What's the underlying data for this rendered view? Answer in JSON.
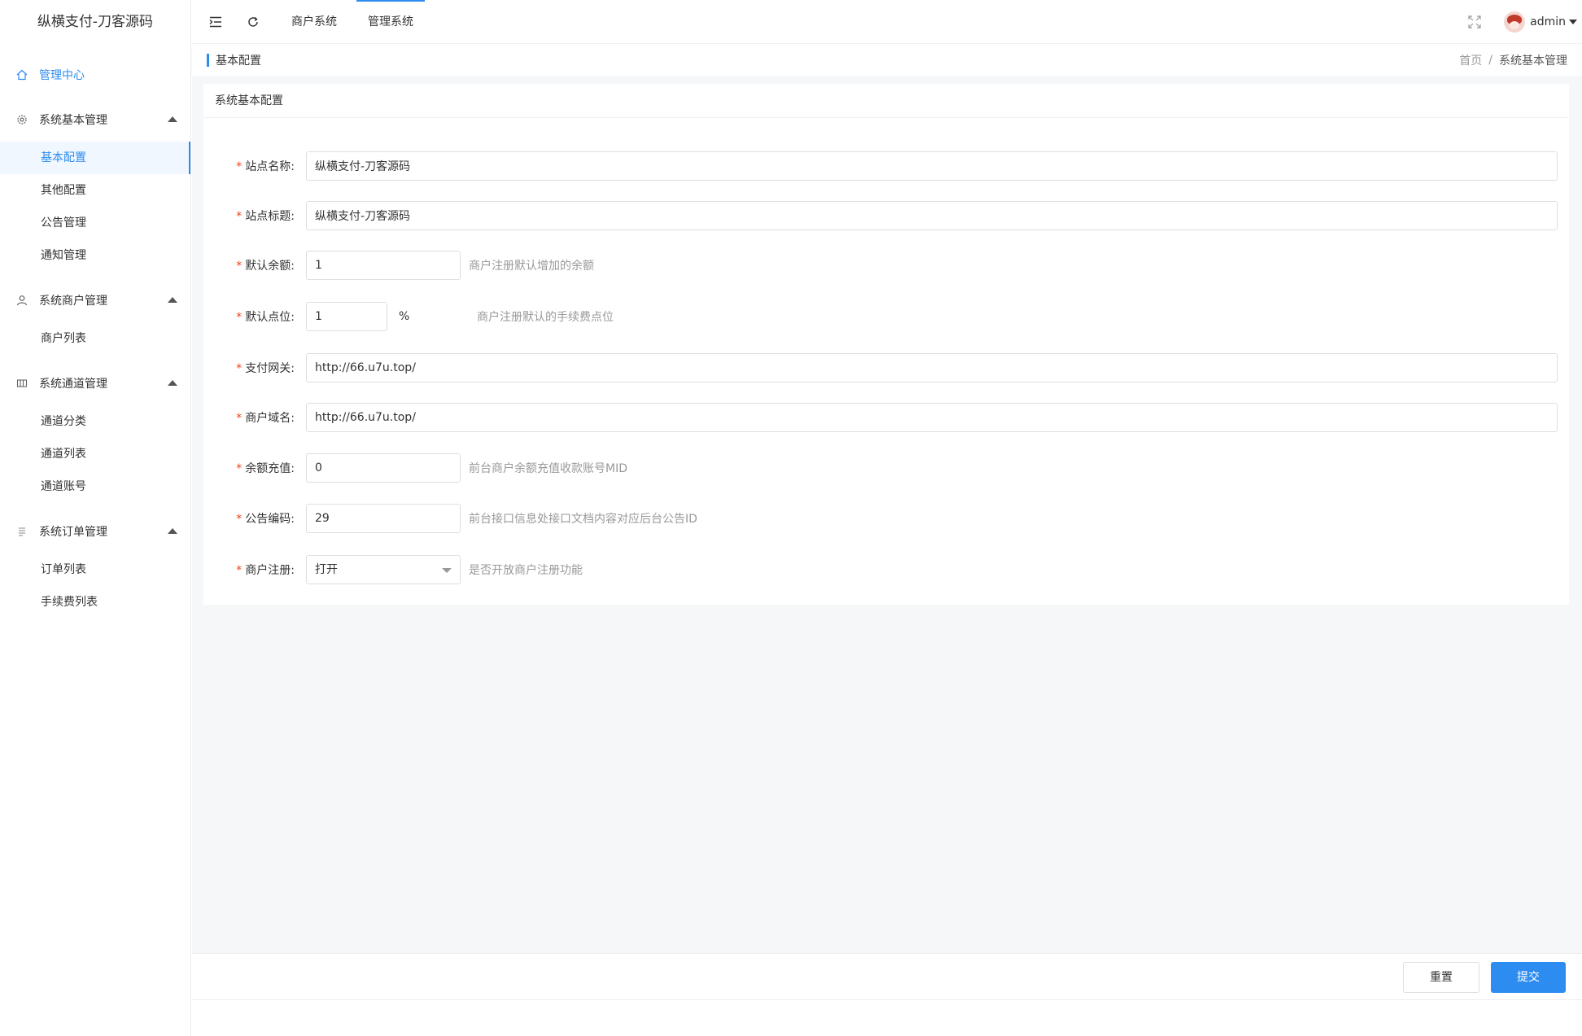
{
  "app": {
    "title": "纵横支付-刀客源码"
  },
  "sidebar": {
    "top_item": {
      "label": "管理中心",
      "icon": "home-icon"
    },
    "groups": [
      {
        "label": "系统基本管理",
        "icon": "gear-icon",
        "items": [
          "基本配置",
          "其他配置",
          "公告管理",
          "通知管理"
        ],
        "active_index": 0
      },
      {
        "label": "系统商户管理",
        "icon": "user-icon",
        "items": [
          "商户列表"
        ]
      },
      {
        "label": "系统通道管理",
        "icon": "table-icon",
        "items": [
          "通道分类",
          "通道列表",
          "通道账号"
        ]
      },
      {
        "label": "系统订单管理",
        "icon": "list-icon",
        "items": [
          "订单列表",
          "手续费列表"
        ]
      }
    ]
  },
  "topbar": {
    "nav": [
      {
        "label": "商户系统"
      },
      {
        "label": "管理系统",
        "active": true
      }
    ],
    "username": "admin"
  },
  "page_header": {
    "title": "基本配置",
    "breadcrumb": {
      "home": "首页",
      "separator": "/",
      "current": "系统基本管理"
    }
  },
  "card": {
    "title": "系统基本配置",
    "fields": [
      {
        "label": "站点名称:",
        "value": "纵横支付-刀客源码",
        "required": true
      },
      {
        "label": "站点标题:",
        "value": "纵横支付-刀客源码",
        "required": true
      },
      {
        "label": "默认余额:",
        "value": "1",
        "hint": "商户注册默认增加的余额",
        "required": true
      },
      {
        "label": "默认点位:",
        "value": "1",
        "unit": "%",
        "hint": "商户注册默认的手续费点位",
        "required": true
      },
      {
        "label": "支付网关:",
        "value": "http://66.u7u.top/",
        "required": true
      },
      {
        "label": "商户域名:",
        "value": "http://66.u7u.top/",
        "required": true
      },
      {
        "label": "余额充值:",
        "value": "0",
        "hint": "前台商户余额充值收款账号MID",
        "required": true
      },
      {
        "label": "公告编码:",
        "value": "29",
        "hint": "前台接口信息处接口文档内容对应后台公告ID",
        "required": true
      },
      {
        "label": "商户注册:",
        "value": "打开",
        "hint": "是否开放商户注册功能",
        "required": true
      }
    ],
    "required_mark": "*"
  },
  "footer": {
    "reset_label": "重置",
    "submit_label": "提交"
  },
  "colors": {
    "accent": "#2d8cf0",
    "required": "#ed4014",
    "hint": "#999999",
    "main_bg": "#f5f7f9"
  }
}
